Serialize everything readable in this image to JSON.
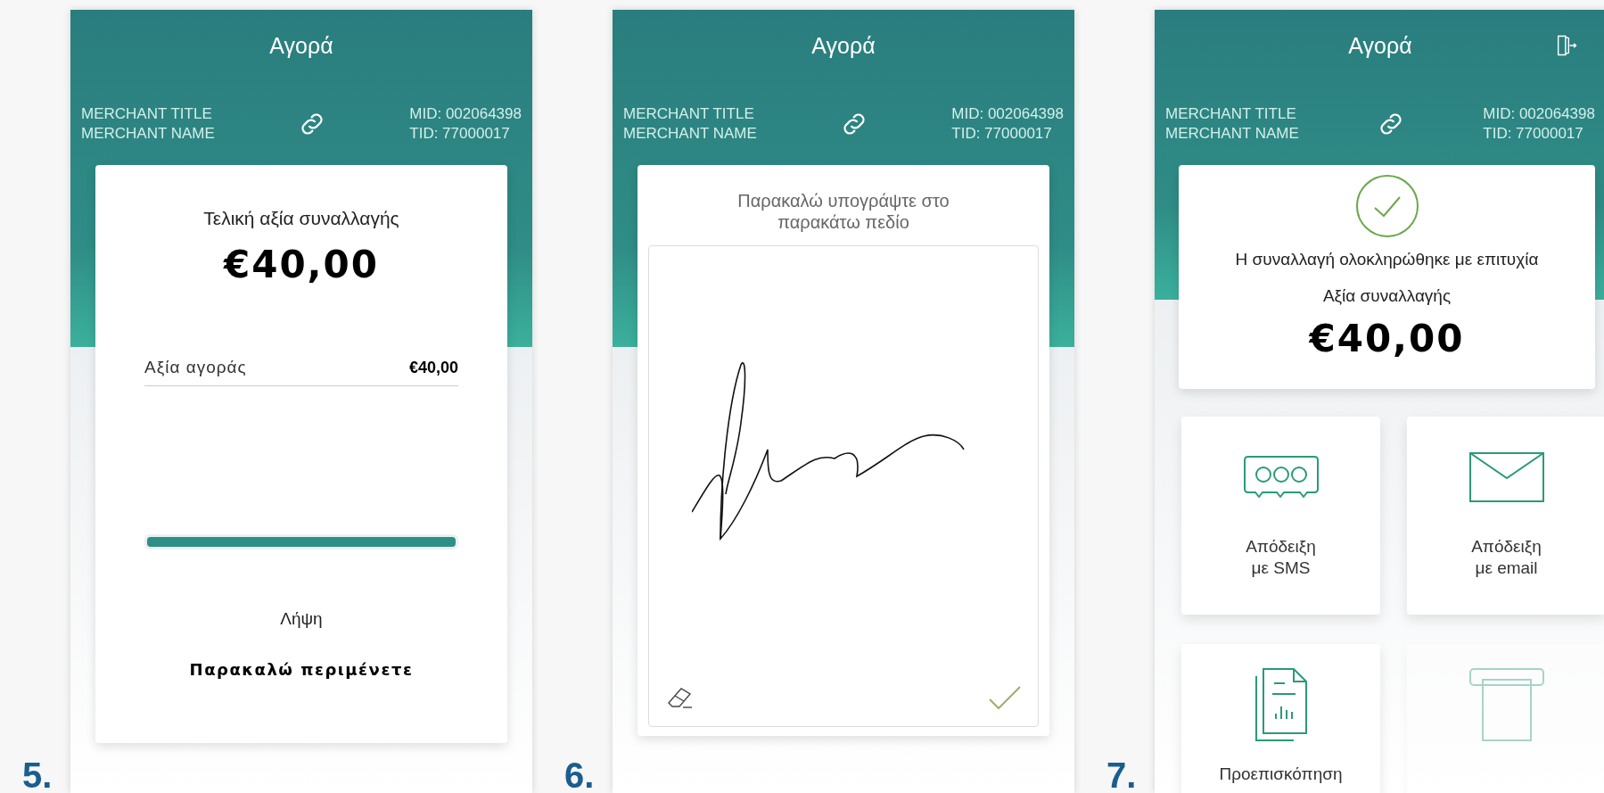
{
  "screens": [
    {
      "number": "5.",
      "header": {
        "title": "Αγορά",
        "merchant_title": "MERCHANT TITLE",
        "merchant_name": "MERCHANT NAME",
        "mid": "MID: 002064398",
        "tid": "TID: 77000017",
        "has_logout": false
      },
      "body": {
        "kind": "processing",
        "label": "Τελική αξία συναλλαγής",
        "amount": "€40,00",
        "line": {
          "label": "Αξία αγοράς",
          "value": "€40,00"
        },
        "progress": {
          "level": 1
        },
        "status": "Λήψη",
        "message": "Παρακαλώ περιμένετε"
      }
    },
    {
      "number": "6.",
      "header": {
        "title": "Αγορά",
        "merchant_title": "MERCHANT TITLE",
        "merchant_name": "MERCHANT NAME",
        "mid": "MID: 002064398",
        "tid": "TID: 77000017",
        "has_logout": false
      },
      "body": {
        "kind": "signature",
        "prompt": "Παρακαλώ υπογράψτε στο παρακάτω πεδίο"
      }
    },
    {
      "number": "7.",
      "header": {
        "title": "Αγορά",
        "merchant_title": "MERCHANT TITLE",
        "merchant_name": "MERCHANT NAME",
        "mid": "MID: 002064398",
        "tid": "TID: 77000017",
        "has_logout": true
      },
      "body": {
        "kind": "receipt",
        "message": "Η συναλλαγή ολοκληρώθηκε με επιτυχία",
        "label": "Αξία συναλλαγής",
        "amount": "€40,00",
        "options": [
          {
            "kind": "sms",
            "lines": [
              "Απόδειξη",
              "με SMS"
            ],
            "disabled": false
          },
          {
            "kind": "email",
            "lines": [
              "Απόδειξη",
              "με email"
            ],
            "disabled": false
          },
          {
            "kind": "preview",
            "lines": [
              "Προεπισκόπηση"
            ],
            "disabled": false
          },
          {
            "kind": "print",
            "disabled": true
          }
        ]
      }
    }
  ]
}
